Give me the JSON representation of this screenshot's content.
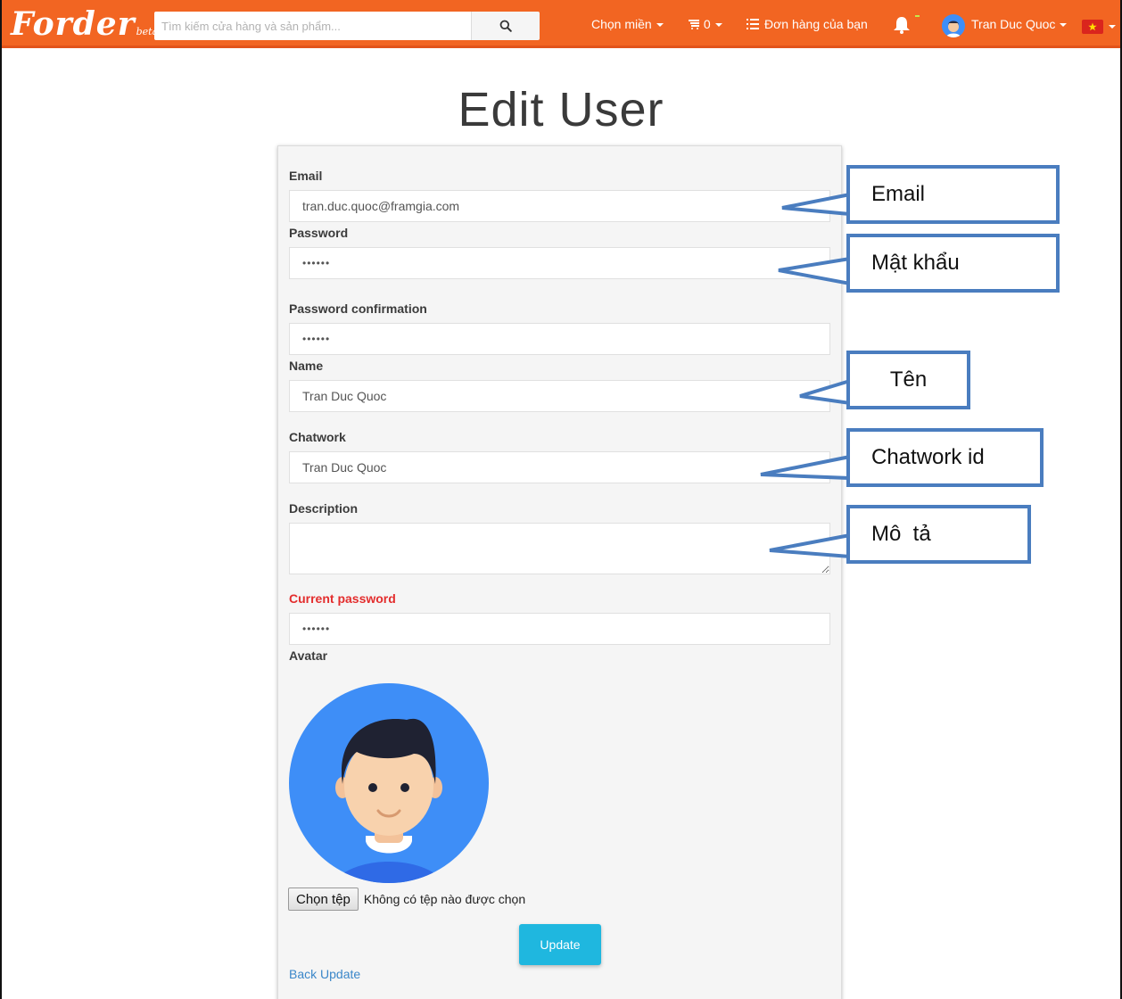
{
  "navbar": {
    "logo_text": "Forder",
    "logo_beta": "beta",
    "search_placeholder": "Tìm kiếm cửa hàng và sản phẩm...",
    "region_label": "Chọn miền",
    "cart_count": "0",
    "orders_label": "Đơn hàng của bạn",
    "user_name": "Tran Duc Quoc"
  },
  "page": {
    "title": "Edit User"
  },
  "form": {
    "email_label": "Email",
    "email_value": "tran.duc.quoc@framgia.com",
    "password_label": "Password",
    "password_value": "••••••",
    "password_confirmation_label": "Password confirmation",
    "password_confirmation_value": "••••••",
    "name_label": "Name",
    "name_value": "Tran Duc Quoc",
    "chatwork_label": "Chatwork",
    "chatwork_value": "Tran Duc Quoc",
    "description_label": "Description",
    "description_value": "",
    "current_password_label": "Current password",
    "current_password_value": "••••••",
    "avatar_label": "Avatar",
    "file_button": "Chọn tệp",
    "file_status": "Không có tệp nào được chọn",
    "update_button": "Update",
    "back_link": "Back Update"
  },
  "callouts": {
    "email": "Email",
    "password": "Mật khẩu",
    "name": "Tên",
    "chatwork": "Chatwork id",
    "description": "Mô  tả"
  },
  "colors": {
    "navbar": "#f26522",
    "callout_border": "#4a7dbf",
    "update_button": "#1fb7df",
    "required_label": "#e32d2d",
    "link": "#3b87c9"
  }
}
